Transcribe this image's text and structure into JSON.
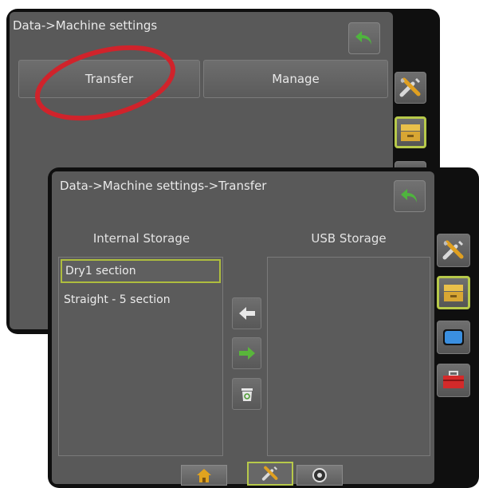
{
  "back_screen": {
    "title": "Data->Machine settings",
    "tabs": [
      {
        "label": "Transfer"
      },
      {
        "label": "Manage"
      }
    ]
  },
  "front_screen": {
    "title": "Data->Machine settings->Transfer",
    "internal_storage": {
      "label": "Internal Storage",
      "items": [
        "Dry1 section",
        "Straight - 5 section"
      ],
      "selected_index": 0
    },
    "usb_storage": {
      "label": "USB Storage",
      "items": []
    }
  },
  "side_icons": [
    "tools-icon",
    "data-icon",
    "display-icon",
    "toolbox-icon"
  ],
  "bottom_tabs": [
    "home-icon",
    "tools-icon",
    "gnss-icon"
  ],
  "annotation": {
    "highlight_color": "#d0232b"
  },
  "colors": {
    "accent": "#b7c94a",
    "arrow_green": "#59b63b",
    "back_arrow_green": "#4fb43e"
  }
}
